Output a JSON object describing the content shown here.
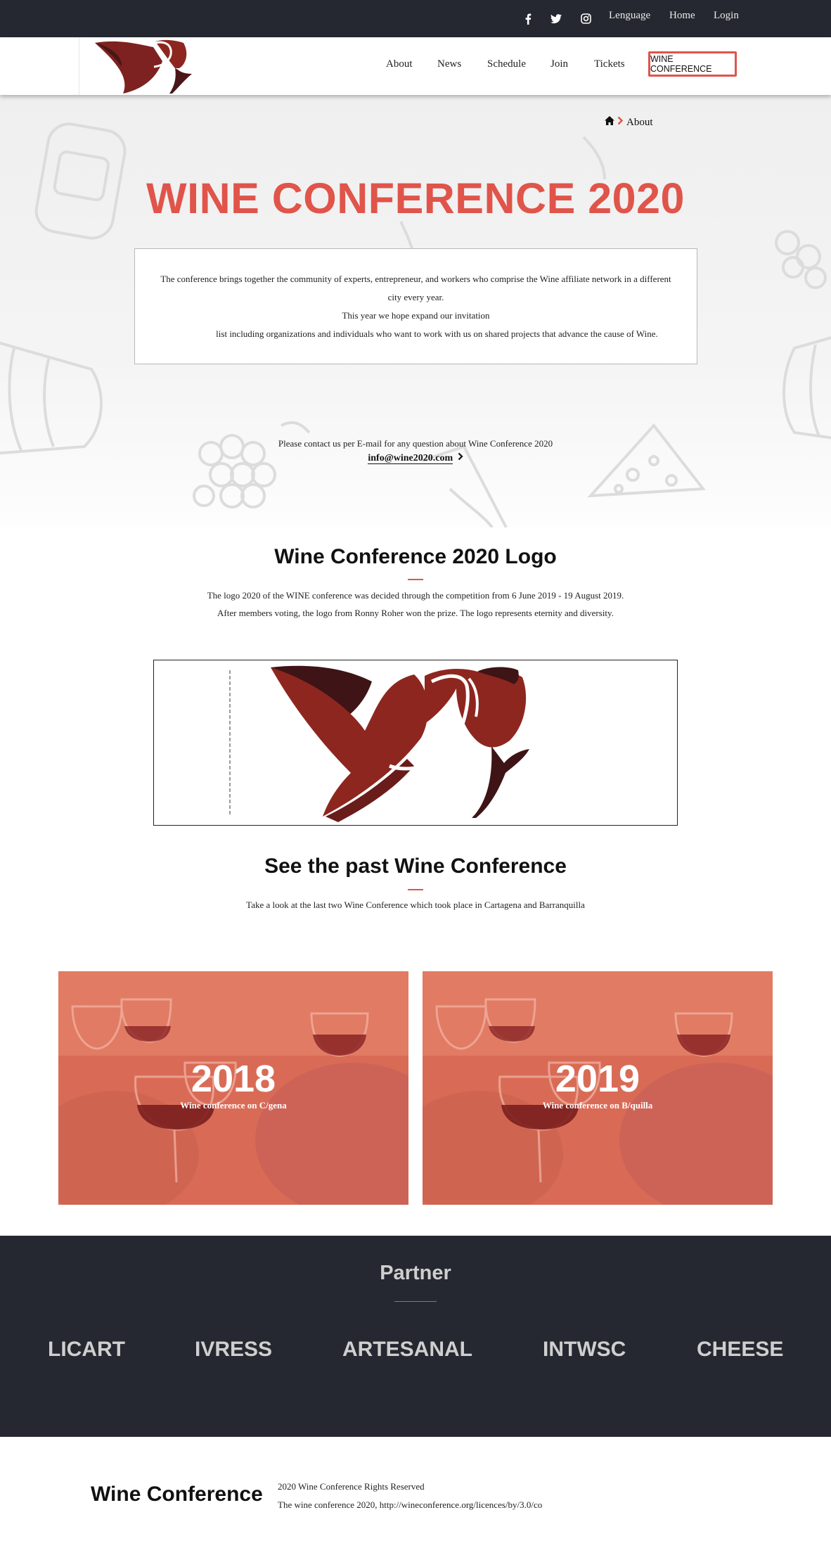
{
  "topbar": {
    "social": [
      {
        "icon": "facebook-icon",
        "glyph": "f"
      },
      {
        "icon": "twitter-icon"
      },
      {
        "icon": "instagram-icon"
      }
    ],
    "links": [
      "Lenguage",
      "Home",
      "Login"
    ]
  },
  "nav": {
    "items": [
      "About",
      "News",
      "Schedule",
      "Join",
      "Tickets"
    ],
    "cta": "WINE CONFERENCE"
  },
  "breadcrumb": {
    "home_icon": "home-icon",
    "separator_icon": "chevron-right-icon",
    "current": "About"
  },
  "hero": {
    "title": "WINE CONFERENCE 2020",
    "paragraphs": [
      "The conference brings together the community of experts, entrepreneur, and workers who comprise the Wine affiliate network in a different city every year.",
      "This year we hope expand our invitation",
      "list including organizations and individuals who want to work with us on shared projects that advance the cause of Wine."
    ],
    "contact_text": "Please contact us per E-mail for any question about Wine Conference 2020",
    "contact_email": "info@wine2020.com"
  },
  "logo_section": {
    "title": "Wine Conference 2020 Logo",
    "lines": [
      "The logo 2020 of the WINE conference was decided through the competition from 6 June 2019 - 19 August 2019.",
      "After members voting, the logo from Ronny Roher won the prize. The logo represents eternity and diversity."
    ]
  },
  "past_section": {
    "title": "See the past Wine Conference",
    "text": "Take a look at the last two Wine Conference which took place in Cartagena and Barranquilla",
    "cards": [
      {
        "year": "2018",
        "caption": "Wine conference on C/gena"
      },
      {
        "year": "2019",
        "caption": "Wine conference on B/quilla"
      }
    ]
  },
  "partner": {
    "title": "Partner",
    "names": [
      "LICART",
      "IVRESS",
      "ARTESANAL",
      "INTWSC",
      "CHEESE"
    ]
  },
  "footer": {
    "brand": "Wine Conference",
    "rights": "2020 Wine Conference Rights Reserved",
    "license": "The wine conference 2020, http://wineconference.org/licences/by/3.0/co"
  },
  "colors": {
    "accent": "#e0544a",
    "dark": "#252830",
    "wine_dark": "#4a1618",
    "wine_red": "#8e2620"
  }
}
